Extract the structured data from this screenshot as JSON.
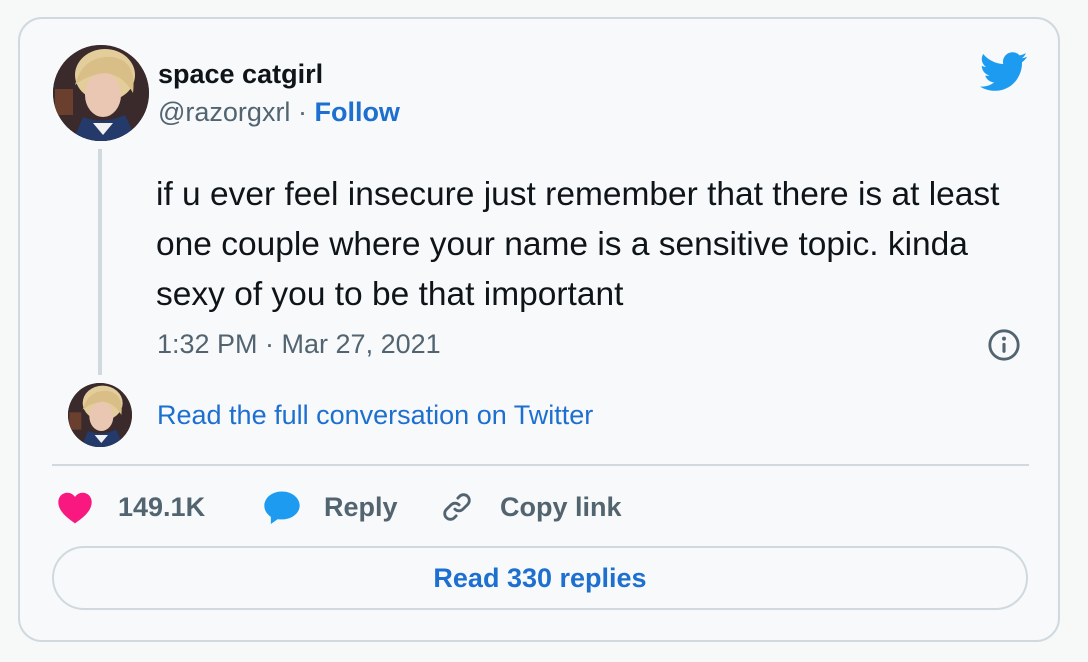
{
  "author": {
    "display_name": "space catgirl",
    "handle": "@razorgxrl",
    "separator": "·",
    "follow_label": "Follow",
    "avatar_icon": "avatar-photo"
  },
  "tweet": {
    "text": "if u ever feel insecure just remember that there is at least one couple where your name is a sensitive topic. kinda sexy of you to be that important",
    "timestamp": "1:32 PM · Mar 27, 2021"
  },
  "conversation": {
    "link_label": "Read the full conversation on Twitter"
  },
  "actions": {
    "likes_count": "149.1K",
    "reply_label": "Reply",
    "copy_link_label": "Copy link"
  },
  "replies_button": {
    "label": "Read 330 replies"
  },
  "icons": {
    "brand": "twitter-bird-icon",
    "info": "info-icon",
    "like": "heart-icon",
    "reply": "speech-bubble-icon",
    "copy": "link-icon"
  },
  "colors": {
    "brand_blue": "#1d9bf0",
    "link_blue": "#1d6fd0",
    "heart_pink": "#f91880",
    "secondary_text": "#536471",
    "border": "#cfd9de"
  }
}
